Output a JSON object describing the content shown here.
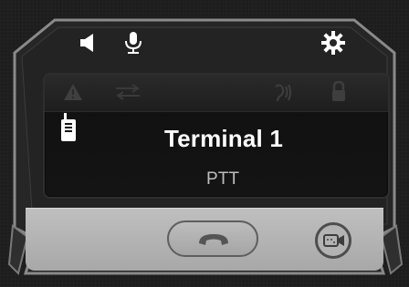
{
  "terminal": {
    "name": "Terminal 1",
    "mode": "PTT"
  },
  "icons": {
    "speaker": "speaker-icon",
    "microphone": "microphone-icon",
    "settings": "gear-icon",
    "warning": "warning-icon",
    "transfer": "transfer-arrows-icon",
    "hearing": "hearing-icon",
    "lock": "lock-icon",
    "radio": "radio-device-icon",
    "hangup": "hangup-icon",
    "video": "video-camera-icon"
  },
  "colors": {
    "frame": "#2a2a2a",
    "accent_white": "#ffffff",
    "bottom_bar": "#b5b5b5"
  }
}
